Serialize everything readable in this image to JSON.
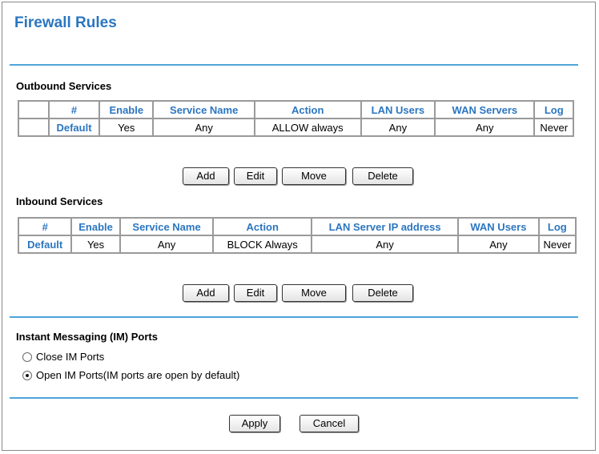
{
  "page": {
    "title": "Firewall Rules"
  },
  "outbound": {
    "section_title": "Outbound Services",
    "headers": [
      "",
      "#",
      "Enable",
      "Service Name",
      "Action",
      "LAN Users",
      "WAN Servers",
      "Log"
    ],
    "rows": [
      {
        "select": "",
        "num": "Default",
        "enable": "Yes",
        "service": "Any",
        "action": "ALLOW always",
        "lan": "Any",
        "wan": "Any",
        "log": "Never"
      }
    ],
    "buttons": {
      "add": "Add",
      "edit": "Edit",
      "move": "Move",
      "delete": "Delete"
    }
  },
  "inbound": {
    "section_title": "Inbound Services",
    "headers": [
      "#",
      "Enable",
      "Service Name",
      "Action",
      "LAN Server IP address",
      "WAN Users",
      "Log"
    ],
    "rows": [
      {
        "num": "Default",
        "enable": "Yes",
        "service": "Any",
        "action": "BLOCK Always",
        "lan": "Any",
        "wan": "Any",
        "log": "Never"
      }
    ],
    "buttons": {
      "add": "Add",
      "edit": "Edit",
      "move": "Move",
      "delete": "Delete"
    }
  },
  "im": {
    "section_title": "Instant Messaging (IM) Ports",
    "options": [
      {
        "label": "Close IM Ports",
        "checked": false
      },
      {
        "label": "Open IM Ports(IM ports are open by default)",
        "checked": true
      }
    ]
  },
  "footer": {
    "apply": "Apply",
    "cancel": "Cancel"
  },
  "colors": {
    "accent": "#2b76c0",
    "rule": "#4da4d9",
    "border": "#9a9a9a"
  }
}
